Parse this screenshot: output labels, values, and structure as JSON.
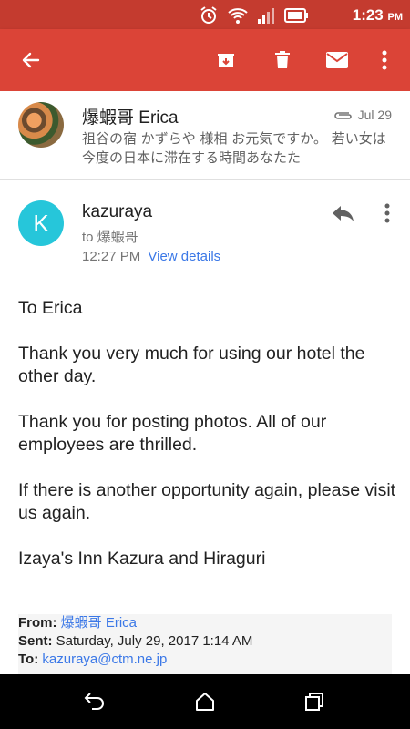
{
  "status_bar": {
    "time": "1:23",
    "ampm": "PM"
  },
  "thread": {
    "sender": "爆蝦哥 Erica",
    "date": "Jul 29",
    "snippet": "祖谷の宿 かずらや 様相 お元気ですか。 若い女は今度の日本に滞在する時間あなたた"
  },
  "message": {
    "avatar_letter": "K",
    "from": "kazuraya",
    "to": "to 爆蝦哥",
    "time": "12:27 PM",
    "view_details": "View details"
  },
  "body": {
    "paragraphs": [
      "To Erica",
      "Thank you very much for using our hotel the other day.",
      "Thank you for posting photos. All of our employees are thrilled.",
      "If there is another opportunity again, please visit us again.",
      "Izaya's Inn Kazura and Hiraguri"
    ]
  },
  "quote": {
    "from_label": "From:",
    "from_value": "爆蝦哥 Erica",
    "sent_label": "Sent:",
    "sent_value": "Saturday, July 29, 2017 1:14 AM",
    "to_label": "To:",
    "to_value": "kazuraya@ctm.ne.jp"
  },
  "colors": {
    "toolbar": "#db4437",
    "status_bar": "#c43b2f",
    "avatar_k": "#26c6da",
    "link": "#3b78e7"
  }
}
